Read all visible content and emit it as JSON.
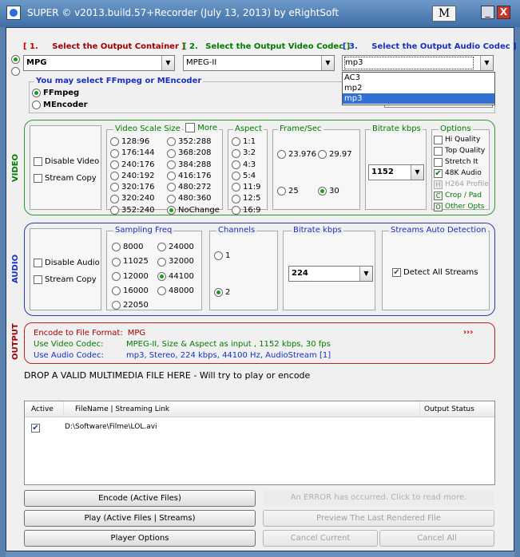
{
  "window": {
    "title": "SUPER © v2013.build.57+Recorder (July 13, 2013) by eRightSoft",
    "m_badge": "M",
    "minimize": "_",
    "close": "X"
  },
  "colors": {
    "green": "#007a00",
    "red": "#c80000",
    "blue": "#1a2fc0",
    "highlight": "#3370d4"
  },
  "headers": {
    "container_num": "[ 1.",
    "container_label": "Select the Output Container ]",
    "video_num": "[ 2.",
    "video_label": "Select the Output Video Codec ]",
    "audio_num": "[ 3.",
    "audio_label": "Select the Output Audio Codec ]"
  },
  "combos": {
    "container": "MPG",
    "video_codec": "MPEG-II",
    "audio_codec": "mp3",
    "audio_options": [
      "AC3",
      "mp2",
      "mp3"
    ],
    "audio_highlighted": "mp3"
  },
  "engine": {
    "title": "You may select FFmpeg or MEncoder",
    "ffmpeg": "FFmpeg",
    "mencoder": "MEncoder",
    "selected": "FFmpeg"
  },
  "video": {
    "section_label": "VIDEO",
    "disable_video": "Disable Video",
    "stream_copy": "Stream Copy",
    "scale_title": "Video Scale Size",
    "more_label": "More",
    "scale_col1": [
      "128:96",
      "176:144",
      "240:176",
      "240:192",
      "320:176",
      "320:240",
      "352:240"
    ],
    "scale_col2": [
      "352:288",
      "368:208",
      "384:288",
      "416:176",
      "480:272",
      "480:360",
      "NoChange"
    ],
    "scale_selected": "NoChange",
    "aspect_title": "Aspect",
    "aspects": [
      "1:1",
      "3:2",
      "4:3",
      "5:4",
      "11:9",
      "12:5",
      "16:9"
    ],
    "framerate_title": "Frame/Sec",
    "framerates": [
      "23.976",
      "29.97",
      "25",
      "30"
    ],
    "framerate_selected": "30",
    "bitrate_title": "Bitrate  kbps",
    "bitrate_value": "1152",
    "options_title": "Options",
    "options": [
      "Hi Quality",
      "Top Quality",
      "Stretch It",
      "48K Audio",
      "H264 Profile"
    ],
    "options_checked": [
      "48K Audio"
    ],
    "crop_pad": "Crop / Pad",
    "other_opts": "Other Opts"
  },
  "audio": {
    "section_label": "AUDIO",
    "disable_audio": "Disable Audio",
    "stream_copy": "Stream Copy",
    "sampling_title": "Sampling Freq",
    "sampling_col1": [
      "8000",
      "11025",
      "12000",
      "16000",
      "22050"
    ],
    "sampling_col2": [
      "24000",
      "32000",
      "44100",
      "48000"
    ],
    "sampling_selected": "44100",
    "channels_title": "Channels",
    "channels": [
      "1",
      "2"
    ],
    "channels_selected": "2",
    "bitrate_title": "Bitrate  kbps",
    "bitrate_value": "224",
    "streams_title": "Streams Auto Detection",
    "detect_all": "Detect All Streams"
  },
  "output": {
    "section_label": "OUTPUT",
    "format_label": "Encode to File Format:",
    "format_value": "MPG",
    "video_label": "Use Video Codec:",
    "video_value": "MPEG-II,  Size & Aspect as input ,  1152 kbps,  30 fps",
    "audio_label": "Use Audio Codec:",
    "audio_value": "mp3,  Stereo,  224 kbps,  44100 Hz,  AudioStream [1]",
    "more_arrow": "›››"
  },
  "drop_text": "DROP A VALID MULTIMEDIA FILE HERE - Will try to play or encode",
  "file_list": {
    "columns": [
      "Active",
      "FileName  |  Streaming Link",
      "Output Status"
    ],
    "rows": [
      {
        "active": true,
        "file": "D:\\Software\\Filme\\LOL.avi",
        "status": ""
      }
    ]
  },
  "buttons": {
    "encode": "Encode (Active Files)",
    "error": "An ERROR has occurred. Click to read more.",
    "play": "Play (Active Files | Streams)",
    "preview": "Preview The Last Rendered File",
    "player_options": "Player Options",
    "cancel_current": "Cancel Current",
    "cancel_all": "Cancel All"
  }
}
